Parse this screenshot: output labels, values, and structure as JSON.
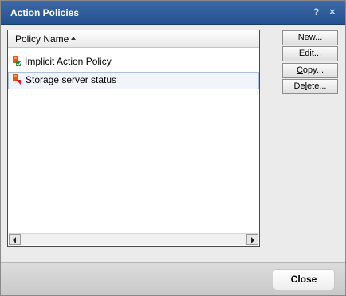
{
  "window": {
    "title": "Action Policies",
    "help_label": "?",
    "close_label": "×"
  },
  "list": {
    "column_header": "Policy Name",
    "sort_direction": "ascending",
    "rows": [
      {
        "label": "Implicit Action Policy",
        "icon": "policy-icon",
        "selected": false
      },
      {
        "label": "Storage server status",
        "icon": "policy-icon",
        "selected": true
      }
    ]
  },
  "buttons": {
    "new": {
      "accel": "N",
      "rest": "ew..."
    },
    "edit": {
      "accel": "E",
      "rest": "dit..."
    },
    "copy": {
      "accel": "C",
      "rest": "opy..."
    },
    "delete": {
      "pre": "De",
      "accel": "l",
      "rest": "ete..."
    }
  },
  "footer": {
    "close_label": "Close"
  },
  "colors": {
    "titlebar": "#2b5797",
    "selection_bg": "#f1f5fb",
    "selection_border": "#aac0dc"
  }
}
